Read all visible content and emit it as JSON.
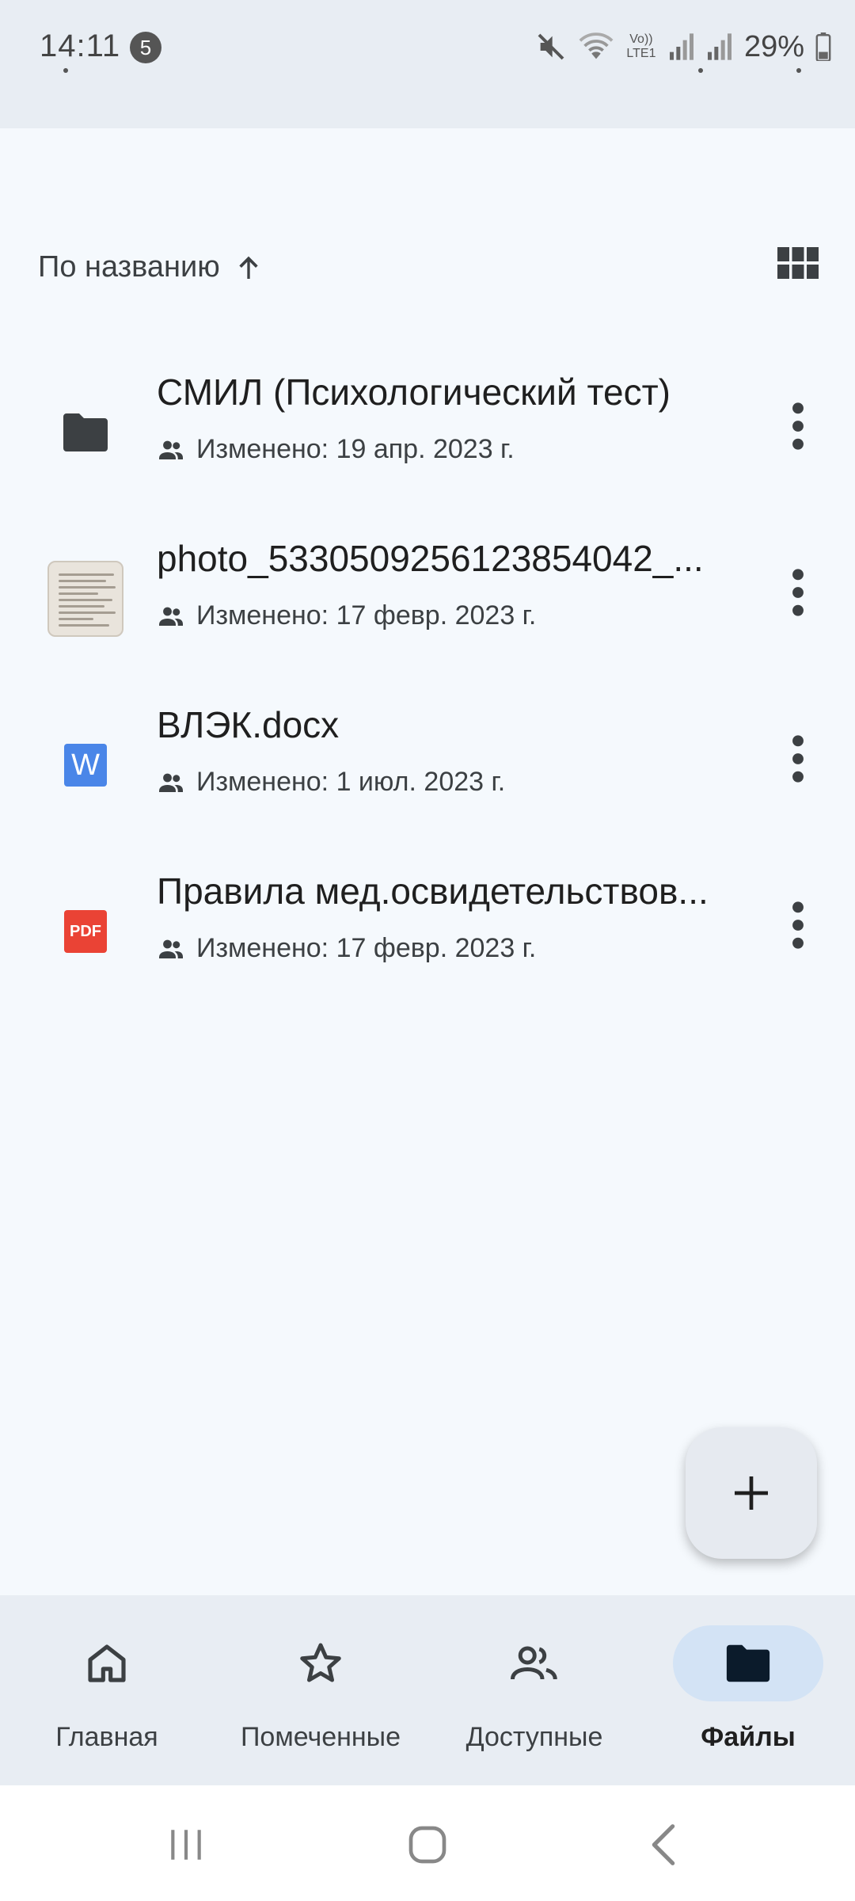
{
  "status_bar": {
    "time": "14:11",
    "notification_count": "5",
    "network_label": "Vo)) LTE1",
    "battery_percent": "29%"
  },
  "toolbar": {
    "sort_label": "По названию",
    "sort_direction_icon": "arrow-up-icon",
    "view_toggle_icon": "grid-view-icon"
  },
  "files": [
    {
      "name": "СМИЛ (Психологический тест)",
      "type": "folder",
      "modified": "Изменено: 19 апр. 2023 г.",
      "shared_icon": "people-icon"
    },
    {
      "name": "photo_5330509256123854042_...",
      "type": "image",
      "modified": "Изменено: 17 февр. 2023 г.",
      "shared_icon": "people-icon"
    },
    {
      "name": "ВЛЭК.docx",
      "type": "word",
      "icon_text": "W",
      "modified": "Изменено: 1 июл. 2023 г.",
      "shared_icon": "people-icon"
    },
    {
      "name": "Правила мед.освидетельствов...",
      "type": "pdf",
      "icon_text": "PDF",
      "modified": "Изменено: 17 февр. 2023 г.",
      "shared_icon": "people-icon"
    }
  ],
  "fab": {
    "icon": "plus-icon"
  },
  "bottom_nav": [
    {
      "label": "Главная",
      "icon": "home-icon",
      "active": false
    },
    {
      "label": "Помеченные",
      "icon": "star-icon",
      "active": false
    },
    {
      "label": "Доступные",
      "icon": "people-icon",
      "active": false
    },
    {
      "label": "Файлы",
      "icon": "folder-icon",
      "active": true
    }
  ],
  "colors": {
    "background": "#f5f9fd",
    "bar_background": "#e8edf3",
    "active_pill": "#d3e3f5",
    "word_blue": "#4a86e8",
    "pdf_red": "#ea4335",
    "folder_dark": "#3c4043"
  }
}
